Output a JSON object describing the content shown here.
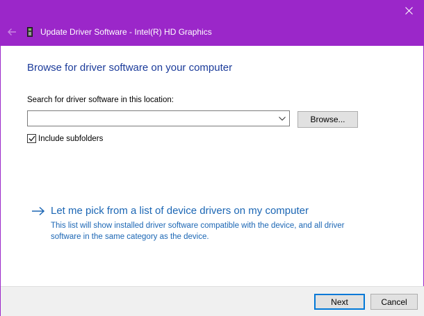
{
  "window": {
    "accent_color": "#9b27c9",
    "close_icon": "close-icon"
  },
  "header": {
    "back_icon": "back-arrow-icon",
    "device_icon": "graphics-card-icon",
    "title": "Update Driver Software - Intel(R) HD Graphics"
  },
  "main": {
    "heading": "Browse for driver software on your computer",
    "search_label": "Search for driver software in this location:",
    "path_value": "",
    "browse_label": "Browse...",
    "include_subfolders_label": "Include subfolders",
    "include_subfolders_checked": true
  },
  "pick": {
    "title": "Let me pick from a list of device drivers on my computer",
    "description": "This list will show installed driver software compatible with the device, and all driver software in the same category as the device."
  },
  "footer": {
    "next_label": "Next",
    "cancel_label": "Cancel"
  }
}
